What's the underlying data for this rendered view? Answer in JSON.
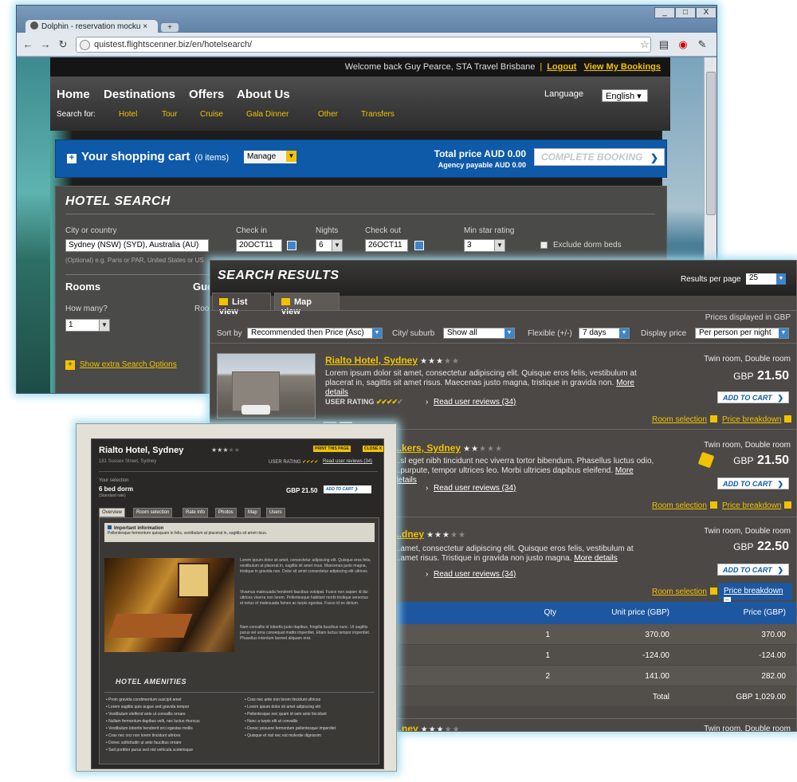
{
  "browser": {
    "tab_title": "Dolphin - reservation mocku",
    "new_tab": "+",
    "window_controls": [
      "_",
      "□",
      "X"
    ],
    "url": "quistest.flightscenner.biz/en/hotelsearch/",
    "nav_icons": [
      "back-icon",
      "forward-icon",
      "reload-icon"
    ],
    "toolbar_icons": [
      "star-icon",
      "page-icon",
      "stop-icon",
      "wrench-icon"
    ]
  },
  "site": {
    "welcome_text": "Welcome back Guy Pearce, STA Travel Brisbane",
    "logout": "Logout",
    "my_bookings": "View My Bookings",
    "nav": [
      "Home",
      "Destinations",
      "Offers",
      "About Us"
    ],
    "search_for_label": "Search for:",
    "search_for": [
      "Hotel",
      "Tour",
      "Cruise",
      "Gala Dinner",
      "Other",
      "Transfers"
    ],
    "language_label": "Language",
    "language_value": "English"
  },
  "cart": {
    "title": "Your shopping cart",
    "items": "(0 items)",
    "manage": "Manage",
    "total": "Total price AUD 0.00",
    "agency": "Agency payable AUD 0.00",
    "complete": "COMPLETE BOOKING"
  },
  "hotel_search": {
    "title": "HOTEL SEARCH",
    "city_label": "City or country",
    "city_value": "Sydney (NSW) (SYD), Australia (AU)",
    "city_hint": "(Optional) e.g. Paris or PAR, United States or US",
    "checkin_label": "Check in",
    "checkin_value": "20OCT11",
    "nights_label": "Nights",
    "nights_value": "6",
    "checkout_label": "Check out",
    "checkout_value": "26OCT11",
    "min_star_label": "Min star rating",
    "min_star_value": "3",
    "exclude_dorm": "Exclude dorm beds",
    "rooms_title": "Rooms",
    "guests_title": "Gue",
    "how_many_label": "How many?",
    "how_many_value": "1",
    "room_label": "Roo",
    "extra": "Show extra Search Options"
  },
  "results": {
    "title": "SEARCH RESULTS",
    "per_page_label": "Results per page",
    "per_page_value": "25",
    "list_view": "List view",
    "map_view": "Map view",
    "prices_displayed": "Prices displayed in GBP",
    "sort_label": "Sort by",
    "sort_value": "Recommended then Price (Asc)",
    "city_label": "City/ suburb",
    "city_value": "Show all",
    "flexible_label": "Flexible (+/-)",
    "flexible_value": "7 days",
    "display_label": "Display price",
    "display_value": "Per person per night",
    "hotels": [
      {
        "name": "Rialto Hotel, Sydney",
        "desc": "Lorem ipsum dolor sit amet, consectetur adipiscing elit. Quisque eros felis, vestibulum at placerat in, sagittis sit amet risus. Maecenas justo magna, tristique in gravida non.",
        "more": "More details",
        "user_rating": "USER RATING",
        "reviews": "Read user reviews (34)",
        "room": "Twin room, Double room",
        "currency": "GBP",
        "price": "21.50",
        "add": "ADD TO CART",
        "room_sel": "Room selection",
        "price_bd": "Price breakdown"
      },
      {
        "name": "...kers, Sydney",
        "desc": "...sl eget nibh tincidunt nec viverra tortor bibendum. Phasellus luctus odio, ...purpute, tempor ultrices leo. Morbi ultricies dapibus eleifend.",
        "more": "More details",
        "reviews": "Read user reviews (34)",
        "room": "Twin room, Double room",
        "currency": "GBP",
        "price": "21.50",
        "add": "ADD TO CART",
        "room_sel": "Room selection",
        "price_bd": "Price breakdown"
      },
      {
        "name": "...dney",
        "desc": "...amet, consectetur adipiscing elit. Quisque eros felis, vestibulum at ...amet risus. Tristique in gravida non justo magna.",
        "more": "More details",
        "reviews": "Read user reviews (34)",
        "room": "Twin room, Double room",
        "currency": "GBP",
        "price": "22.50",
        "add": "ADD TO CART",
        "room_sel": "Room selection",
        "price_bd": "Price breakdown"
      }
    ],
    "breakdown": {
      "headers": [
        "Qty",
        "Unit price (GBP)",
        "Price (GBP)"
      ],
      "rows": [
        [
          "1",
          "370.00",
          "370.00"
        ],
        [
          "1",
          "-124.00",
          "-124.00"
        ],
        [
          "2",
          "141.00",
          "282.00"
        ]
      ],
      "total_label": "Total",
      "total_value": "GBP 1,029.00"
    },
    "next_room": "Twin room, Double room",
    "next_name": "...ney"
  },
  "detail": {
    "title": "Rialto Hotel, Sydney",
    "address": "181 Sussex Street, Sydney",
    "print": "PRINT THIS PAGE",
    "close": "CLOSE X",
    "user_rating": "USER RATING",
    "reviews": "Read user reviews (34)",
    "your_selection": "Your selection",
    "bed": "6 bed dorm",
    "bed_sub": "(Standard rate)",
    "price": "GBP 21.50",
    "add": "ADD TO CART",
    "tabs": [
      "Overview",
      "Room selection",
      "Rate info",
      "Photos",
      "Map",
      "Users"
    ],
    "info_title": "Important information",
    "info_text": "Pellentesque fermentum quisquam in felis, vestibulum at placerat in, sagittis sit amet risus.",
    "para1": "Lorem ipsum dolor sit amet, consectetur adipiscing elit. Quisque eros felis, vestibulum at placerat in, sagittis sit amet risus. Maecenas justo magna, tristique in gravida non. Dolor sit amet consectetur adipiscing elit ultrices.",
    "para2": "Vivamus malesuada hendrerit faucibus volutpat. Fusce non sapien id dui ultrices viverra non lorem. Pellentesque habitant morbi tristique senectus et netus et malesuada fames ac turpis egestas. Fusce id ex dictum.",
    "para3": "Nam convallis id lobortis justo dapibus, fringilla faucibus nunc. Ut sagittis purus vel urna consequat mattis imperdiet. Etiam luctus tempor imperdiet. Phasellus interdum laoreet aliquam erat.",
    "amen_title": "HOTEL AMENITIES",
    "amen_left": [
      "Proin gravida condimentum suscipit amet",
      "Lorem sagittis quis augue sed gravida tempor",
      "Vestibulum eleifend ante ut convallis ornare",
      "Nullam fermentum dapibus velit, nec luctus rhoncus",
      "Vestibulum lobortis hendrerit orci egestas mollis",
      "Cras nec orci non lorem tincidunt ultrices",
      "Donec sollicitudin ut ante faucibus ornare",
      "Sed porttitor purus sed nisl vehicula scelerisque"
    ],
    "amen_right": [
      "Cras nec ante non lorem tincidunt ultrices",
      "Lorem ipsum dolor sit amet adipiscing elit",
      "Pellentesque nec quam id sem ante tincidunt",
      "Nunc a turpis elit ut convallis",
      "Donec posuere fermentum pellentesque imperdiet",
      "Quisque et nisl nec est molestie dignissim"
    ]
  }
}
